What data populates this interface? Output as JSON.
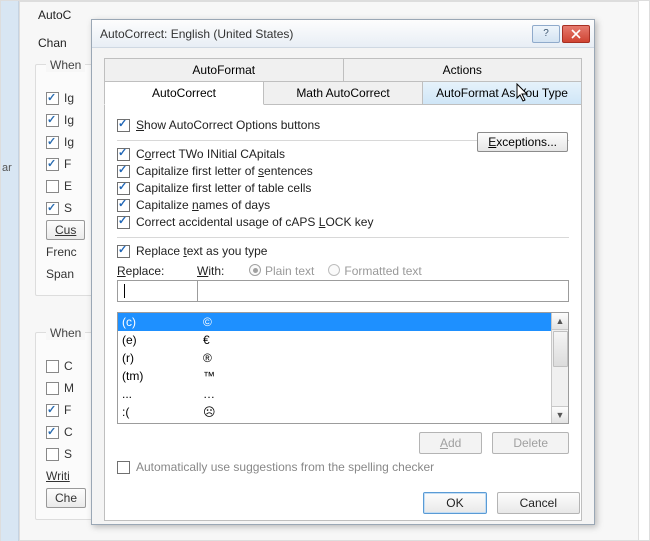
{
  "bg": {
    "header_label": "AutoC",
    "chan_label": "Chan",
    "group1_label": "When",
    "grammar_bar": "ar",
    "g1_items": [
      {
        "checked": true,
        "label": "Ig"
      },
      {
        "checked": true,
        "label": "Ig"
      },
      {
        "checked": true,
        "label": "Ig"
      },
      {
        "checked": true,
        "label": "F"
      },
      {
        "checked": false,
        "label": "E"
      },
      {
        "checked": true,
        "label": "S"
      }
    ],
    "custom_btn": "Cus",
    "french_label": "Frenc",
    "spanish_label": "Span",
    "group2_label": "When",
    "g2_items": [
      {
        "checked": false,
        "label": "C"
      },
      {
        "checked": false,
        "label": "M"
      },
      {
        "checked": true,
        "label": "F"
      },
      {
        "checked": true,
        "label": "C"
      },
      {
        "checked": false,
        "label": "S"
      }
    ],
    "writing_label": "Writi",
    "check_btn": "Che"
  },
  "dialog": {
    "title": "AutoCorrect: English (United States)",
    "tabs_top": [
      {
        "label": "AutoFormat"
      },
      {
        "label": "Actions"
      }
    ],
    "tabs_bottom": [
      {
        "label": "AutoCorrect",
        "active": true,
        "u": ""
      },
      {
        "label": "Math AutoCorrect"
      },
      {
        "label": "AutoFormat As You Type",
        "hover": true,
        "u": "A"
      }
    ],
    "show_options": "Show AutoCorrect Options buttons",
    "correct_caps": "Correct TWo INitial CApitals",
    "capitalize_sentences": "Capitalize first letter of sentences",
    "capitalize_cells": "Capitalize first letter of table cells",
    "capitalize_days": "Capitalize names of days",
    "correct_capslock": "Correct accidental usage of cAPS LOCK key",
    "exceptions_btn": "Exceptions...",
    "replace_text_as_type": "Replace text as you type",
    "replace_label": "Replace:",
    "with_label": "With:",
    "plaintext_label": "Plain text",
    "formatted_label": "Formatted text",
    "list": [
      {
        "from": "(c)",
        "to": "©"
      },
      {
        "from": "(e)",
        "to": "€"
      },
      {
        "from": "(r)",
        "to": "®"
      },
      {
        "from": "(tm)",
        "to": "™"
      },
      {
        "from": "...",
        "to": "…"
      },
      {
        "from": ":(",
        "to": "☹"
      }
    ],
    "add_btn": "Add",
    "delete_btn": "Delete",
    "auto_suggestions": "Automatically use suggestions from the spelling checker",
    "ok_btn": "OK",
    "cancel_btn": "Cancel"
  }
}
